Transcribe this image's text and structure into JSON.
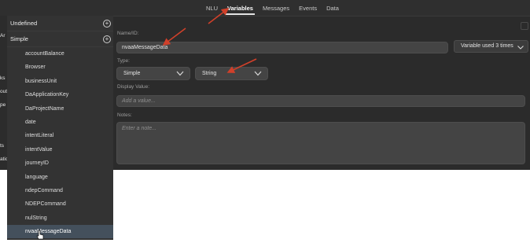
{
  "tabs": [
    {
      "label": "NLU",
      "active": false
    },
    {
      "label": "Variables",
      "active": true
    },
    {
      "label": "Messages",
      "active": false
    },
    {
      "label": "Events",
      "active": false
    },
    {
      "label": "Data",
      "active": false
    }
  ],
  "left_strip": {
    "fragments": [
      "Ar",
      "ks",
      "out",
      "pe",
      "ts",
      "atic"
    ]
  },
  "sidebar": {
    "sections": [
      {
        "label": "Undefined"
      },
      {
        "label": "Simple"
      }
    ],
    "items": [
      "accountBalance",
      "Browser",
      "businessUnit",
      "DaApplicationKey",
      "DaProjectName",
      "date",
      "intentLiteral",
      "intentValue",
      "journeyID",
      "language",
      "ndepCommand",
      "NDEPCommand",
      "nulString",
      "nvaaMessageData"
    ],
    "selected_index": 13
  },
  "editor": {
    "name_label": "Name/ID:",
    "name_value": "nvaaMessageData",
    "used_button": "Variable used 3 times",
    "type_label": "Type:",
    "type_value": "Simple",
    "subtype_value": "String",
    "display_label": "Display Value:",
    "display_placeholder": "Add a value...",
    "notes_label": "Notes:",
    "notes_placeholder": "Enter a note..."
  },
  "colors": {
    "background": "#2b2b2b",
    "sidebar": "#333333",
    "selected_row": "#44505c",
    "annotation_arrow": "#d0402a"
  },
  "icons": [
    "add-icon",
    "chevron-down-icon",
    "pointer-cursor-icon"
  ]
}
